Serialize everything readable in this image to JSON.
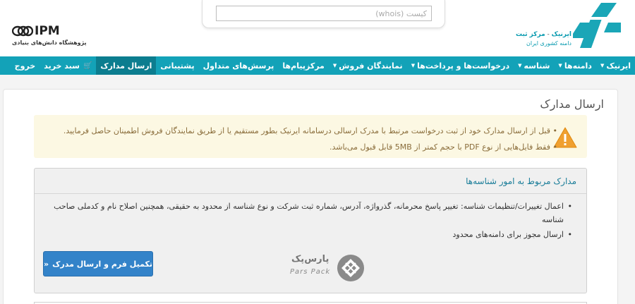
{
  "header": {
    "search_placeholder": "کیست (whois)",
    "logo_irnic": {
      "name": "ایرنیک",
      "dash": " - ",
      "subtitle_1": "مرکز ثبت",
      "subtitle_2": "دامنه کشوری ایران",
      "color": "#0a9bb0"
    },
    "logo_ipm": {
      "mark_text": "IPM",
      "caption": "پژوهشگاه دانش‌های بنیادی"
    }
  },
  "nav": {
    "background": "#13a2b8",
    "items": [
      {
        "label": "ایرنیک",
        "caret": true
      },
      {
        "label": "دامنه‌ها",
        "caret": true
      },
      {
        "label": "شناسه",
        "caret": true
      },
      {
        "label": "درخواست‌ها و پرداخت‌ها",
        "caret": true
      },
      {
        "label": "نمایندگان فروش",
        "caret": true
      },
      {
        "label": "مرکزپیام‌ها",
        "caret": false
      },
      {
        "label": "پرسش‌های متداول",
        "caret": false
      },
      {
        "label": "پشتیبانی",
        "caret": false
      },
      {
        "label": "ارسال مدارک",
        "caret": false,
        "active": true
      },
      {
        "label": "سبد خرید",
        "icon": "cart-icon"
      },
      {
        "label": "خروج"
      }
    ]
  },
  "main": {
    "title": "ارسال مدارک",
    "alert": {
      "icon": "warning-icon",
      "lines": [
        "قبل از ارسال مدارک خود از ثبت درخواست مرتبط با مدرک ارسالی درسامانه ایرنیک بطور مستقیم یا از طریق نمایندگان فروش اطمینان حاصل فرمایید.",
        "فقط فایل‌هایی از نوع PDF با حجم کمتر از 5MB قابل قبول می‌باشد."
      ]
    },
    "card": {
      "title": "مدارک مربوط به امور شناسه‌ها",
      "items": [
        "اعمال تغییرات/تنظیمات شناسه: تغییر پاسخ محرمانه، گذرواژه، آدرس، شماره ثبت شرکت و نوع شناسه از محدود به حقیقی، همچنین اصلاح نام و کدملی صاحب شناسه",
        "ارسال مجوز برای دامنه‌های محدود"
      ],
      "button_label": "تکمیل فرم و ارسال مدرک",
      "button_arrow": "«",
      "button_color": "#3383c9",
      "watermark_fa": "پارس‌پک",
      "watermark_en": "Pars Pack"
    }
  }
}
